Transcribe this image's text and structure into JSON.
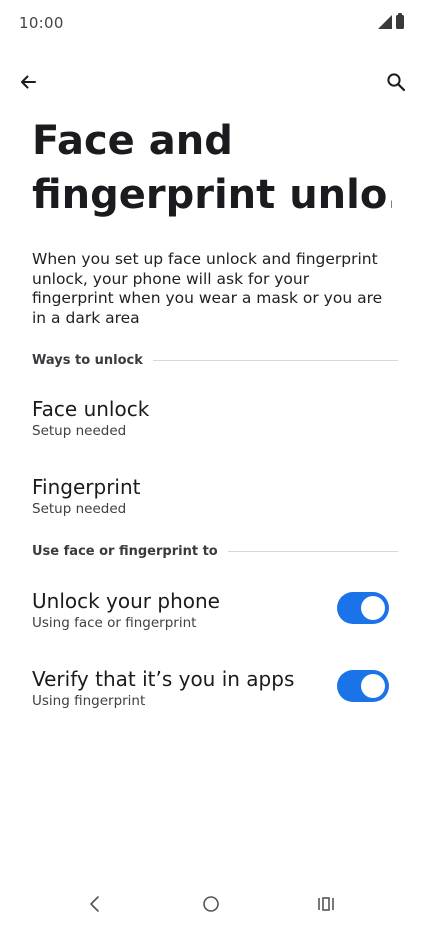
{
  "status_bar": {
    "time": "10:00"
  },
  "toolbar": {
    "back_icon": "arrow-back-icon",
    "search_icon": "search-icon"
  },
  "page": {
    "title_line1": "Face and",
    "title_line2": "fingerprint unlo...",
    "description": "When you set up face unlock and fingerprint unlock, your phone will ask for your fingerprint when you wear a mask or you are in a dark area"
  },
  "sections": {
    "ways_to_unlock": "Ways to unlock",
    "use_for": "Use face or fingerprint to"
  },
  "items": {
    "face_unlock": {
      "title": "Face unlock",
      "summary": "Setup needed"
    },
    "fingerprint": {
      "title": "Fingerprint",
      "summary": "Setup needed"
    },
    "unlock_phone": {
      "title": "Unlock your phone",
      "summary": "Using face or fingerprint",
      "enabled": true
    },
    "verify_apps": {
      "title": "Verify that it’s you in apps",
      "summary": "Using fingerprint",
      "enabled": true
    }
  },
  "colors": {
    "accent": "#1a73e8",
    "text_primary": "#1b1b1f",
    "background": "#ffffff"
  }
}
